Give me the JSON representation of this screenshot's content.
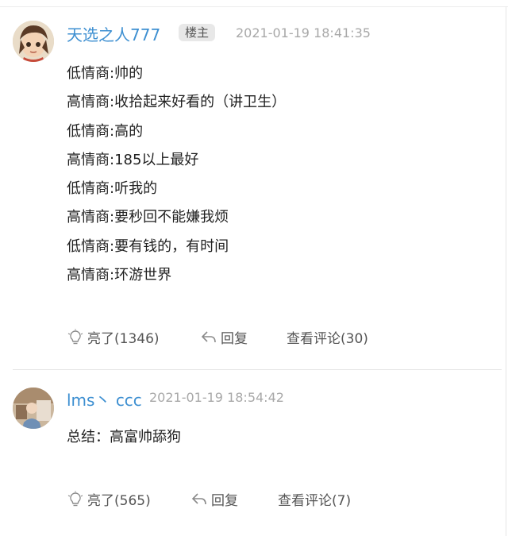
{
  "post1": {
    "username": "天选之人777",
    "badge": "楼主",
    "timestamp": "2021-01-19 18:41:35",
    "lines": [
      "低情商:帅的",
      "高情商:收拾起来好看的（讲卫生）",
      "低情商:高的",
      "高情商:185以上最好",
      "低情商:听我的",
      "高情商:要秒回不能嫌我烦",
      "低情商:要有钱的，有时间",
      "高情商:环游世界"
    ],
    "like_label": "亮了(1346)",
    "reply_label": "回复",
    "comments_label": "查看评论(30)"
  },
  "post2": {
    "username": "lms丶 ccc",
    "timestamp": "2021-01-19 18:54:42",
    "lines": [
      "总结：高富帅舔狗"
    ],
    "like_label": "亮了(565)",
    "reply_label": "回复",
    "comments_label": "查看评论(7)"
  },
  "colors": {
    "username": "#3d8fd1",
    "timestamp": "#a8a8a8",
    "badge_bg": "#e8e8e8",
    "text": "#1f1f1f"
  },
  "icons": {
    "like": "lightbulb-icon",
    "reply": "reply-arrow-icon"
  }
}
